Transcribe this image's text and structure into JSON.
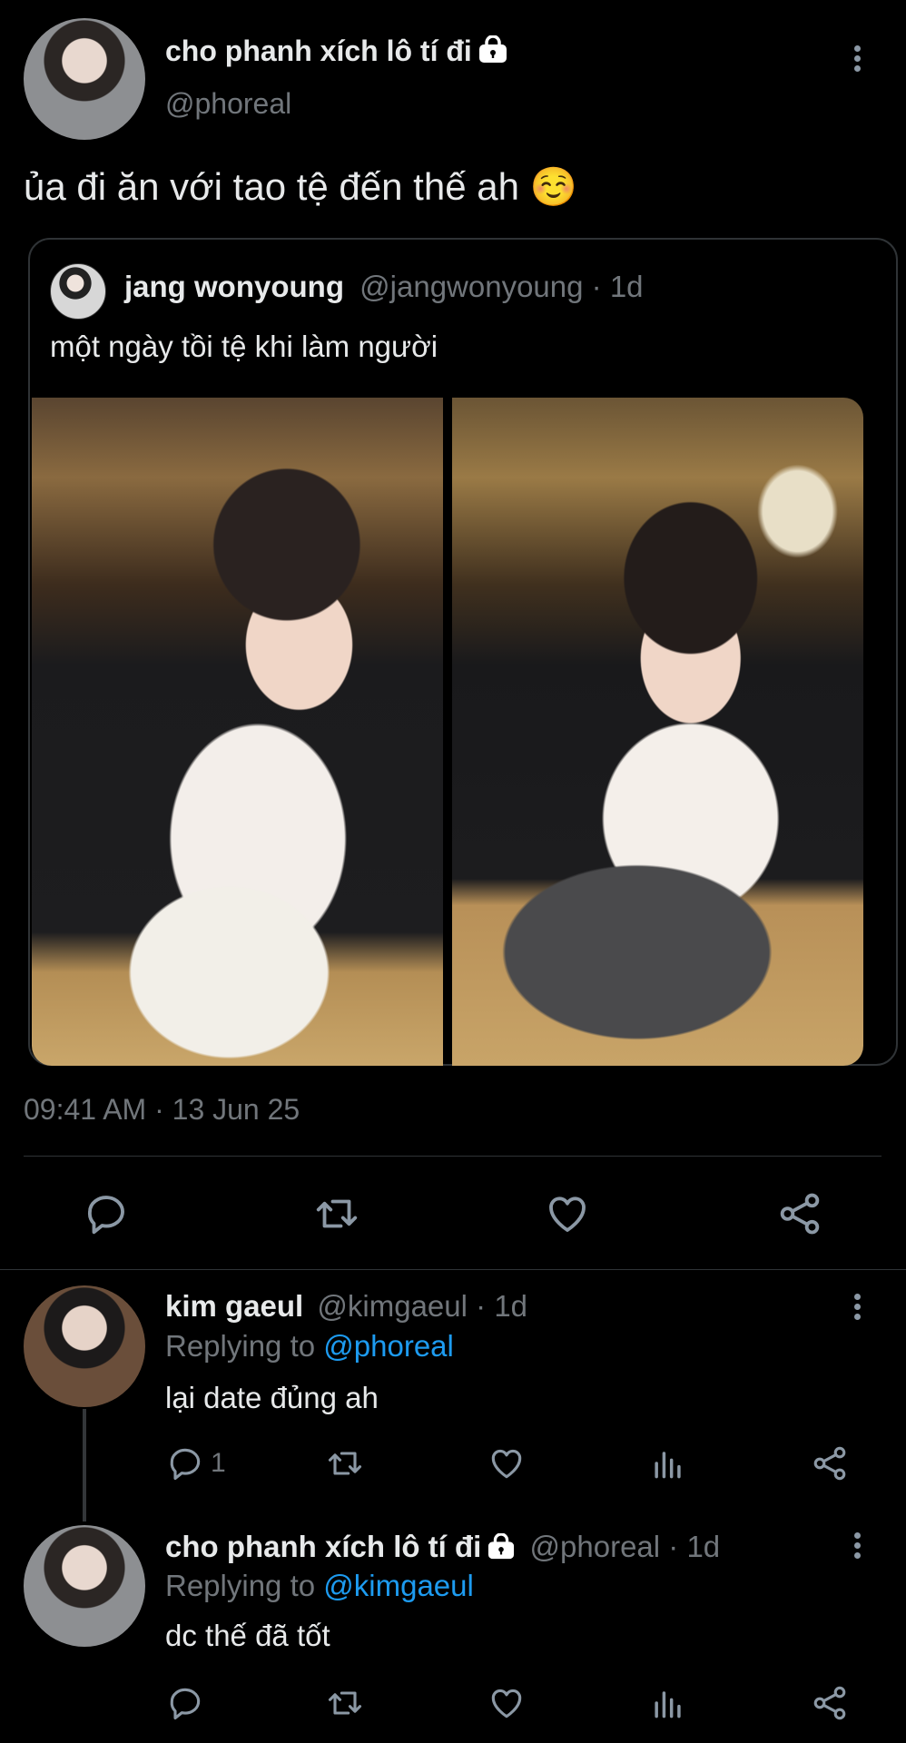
{
  "main_tweet": {
    "author_name": "cho phanh xích lô tí đi",
    "handle": "@phoreal",
    "text": "ủa đi ăn với tao tệ đến thế ah ☺️",
    "timestamp": "09:41 AM · 13 Jun 25",
    "quoted": {
      "author_name": "jang wonyoung",
      "handle": "@jangwonyoung",
      "age": "· 1d",
      "text": "một ngày tồi tệ khi làm người"
    }
  },
  "actions": [
    "reply-icon",
    "retweet-icon",
    "like-icon",
    "share-icon"
  ],
  "replies": [
    {
      "author_name": "kim gaeul",
      "handle": "@kimgaeul",
      "age": "· 1d",
      "replying_prefix": "Replying to",
      "replying_to": "@phoreal",
      "text": "lại date đủng ah",
      "reply_count": "1"
    },
    {
      "author_name": "cho phanh xích lô tí đi",
      "handle": "@phoreal",
      "age": "· 1d",
      "replying_prefix": "Replying to",
      "replying_to": "@kimgaeul",
      "text": "dc thế đã tốt",
      "reply_count": ""
    }
  ],
  "colors": {
    "background": "#000000",
    "text": "#e7e9ea",
    "muted": "#71767b",
    "link": "#1d9bf0",
    "border": "#2f3336"
  }
}
